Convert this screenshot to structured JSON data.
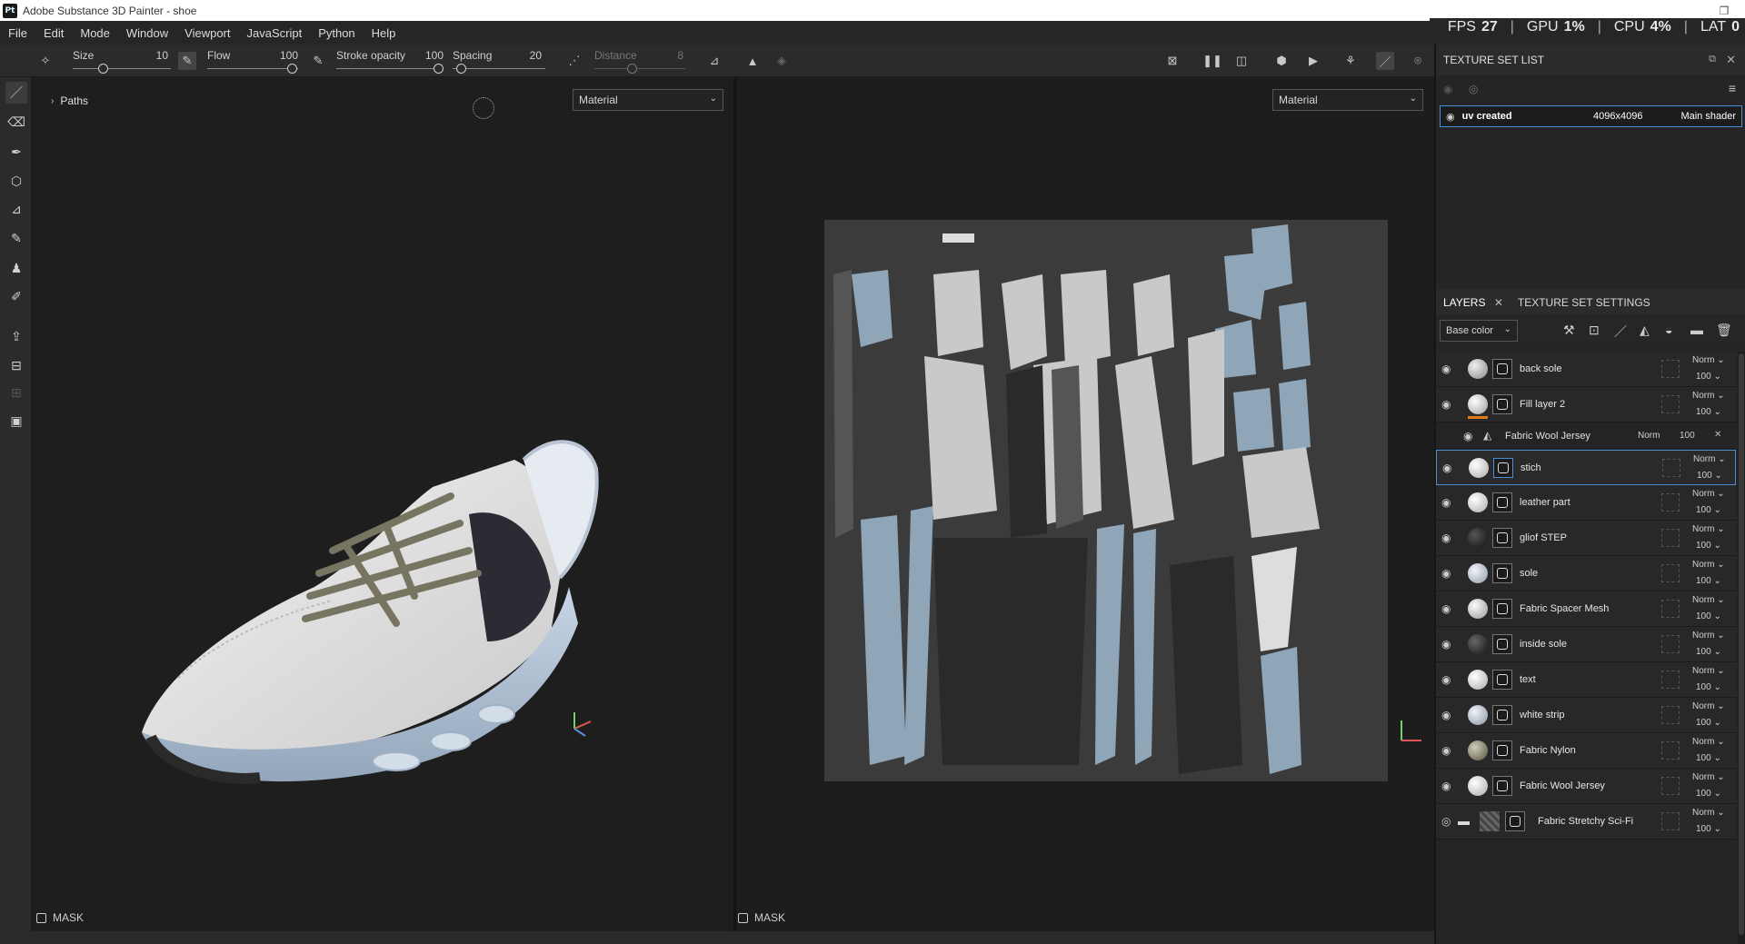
{
  "window": {
    "title": "Adobe Substance 3D Painter - shoe",
    "app_icon_text": "Pt"
  },
  "perf": {
    "fps_label": "FPS",
    "fps": "27",
    "gpu_label": "GPU",
    "gpu": "1%",
    "cpu_label": "CPU",
    "cpu": "4%",
    "lat_label": "LAT",
    "lat": "0"
  },
  "menu": [
    "File",
    "Edit",
    "Mode",
    "Window",
    "Viewport",
    "JavaScript",
    "Python",
    "Help"
  ],
  "toolbar": {
    "size_label": "Size",
    "size_value": "10",
    "flow_label": "Flow",
    "flow_value": "100",
    "stroke_opacity_label": "Stroke opacity",
    "stroke_opacity_value": "100",
    "spacing_label": "Spacing",
    "spacing_value": "20",
    "distance_label": "Distance",
    "distance_value": "8"
  },
  "viewport3d": {
    "paths_label": "Paths",
    "material_dropdown": "Material",
    "mask_label": "MASK"
  },
  "viewport2d": {
    "material_dropdown": "Material",
    "mask_label": "MASK"
  },
  "texture_set_list": {
    "header": "TEXTURE SET LIST",
    "item": {
      "name": "uv created",
      "resolution": "4096x4096",
      "shader": "Main shader"
    }
  },
  "layers_panel": {
    "tab_layers": "LAYERS",
    "tab_texture_set_settings": "TEXTURE SET SETTINGS",
    "channel_dropdown": "Base color",
    "layers": [
      {
        "name": "back sole",
        "blend": "Norm",
        "opacity": "100",
        "thumb": "#9a9a9a"
      },
      {
        "name": "Fill layer 2",
        "blend": "Norm",
        "opacity": "100",
        "thumb": "#bdbdbd"
      },
      {
        "name": "Fabric Wool Jersey",
        "blend": "Norm",
        "opacity": "100",
        "sub": true
      },
      {
        "name": "stich",
        "blend": "Norm",
        "opacity": "100",
        "thumb": "#cfcfcf",
        "selected": true
      },
      {
        "name": "leather part",
        "blend": "Norm",
        "opacity": "100",
        "thumb": "#d2d2d2"
      },
      {
        "name": "gliof STEP",
        "blend": "Norm",
        "opacity": "100",
        "thumb": "#1e1e1e"
      },
      {
        "name": "sole",
        "blend": "Norm",
        "opacity": "100",
        "thumb": "#c9ccd3"
      },
      {
        "name": "Fabric Spacer Mesh",
        "blend": "Norm",
        "opacity": "100",
        "thumb": "#c9c9c9"
      },
      {
        "name": "inside sole",
        "blend": "Norm",
        "opacity": "100",
        "thumb": "#2a2a2a"
      },
      {
        "name": "text",
        "blend": "Norm",
        "opacity": "100",
        "thumb": "#d4d4d4"
      },
      {
        "name": "white strip",
        "blend": "Norm",
        "opacity": "100",
        "thumb": "#c3c9d2"
      },
      {
        "name": "Fabric Nylon",
        "blend": "Norm",
        "opacity": "100",
        "thumb": "#8d8a7a"
      },
      {
        "name": "Fabric Wool Jersey",
        "blend": "Norm",
        "opacity": "100",
        "thumb": "#cfcfcf"
      },
      {
        "name": "Fabric Stretchy Sci-Fi",
        "blend": "Norm",
        "opacity": "100",
        "folder": true
      }
    ]
  },
  "colors": {
    "accent": "#4a8fd6",
    "orange_marker": "#e07b1b",
    "background": "#1e1e1e"
  }
}
